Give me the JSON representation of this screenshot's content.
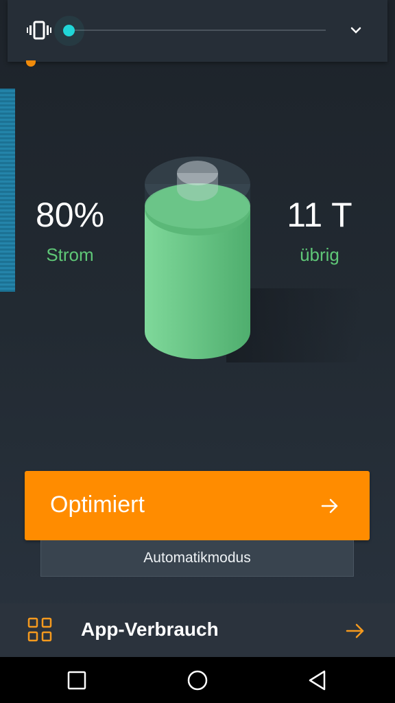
{
  "volume_panel": {
    "icon": "vibrate-icon",
    "slider_level": 0.0,
    "expand_icon": "chevron-down-icon",
    "accent_color": "#20d6d8"
  },
  "stats": {
    "power_value": "80%",
    "power_label": "Strom",
    "remaining_value": "11 T",
    "remaining_label": "übrig"
  },
  "battery": {
    "level": 0.8,
    "fill_color": "#6fcf8a"
  },
  "optimize_button": {
    "label": "Optimiert",
    "icon": "arrow-right-icon",
    "color": "#ff8c00"
  },
  "auto_mode": {
    "label": "Automatikmodus"
  },
  "app_usage": {
    "label": "App-Verbrauch",
    "icon": "grid-icon",
    "arrow_icon": "arrow-right-icon"
  },
  "nav_bar": {
    "items": [
      "recent-apps-icon",
      "home-icon",
      "back-icon"
    ]
  }
}
